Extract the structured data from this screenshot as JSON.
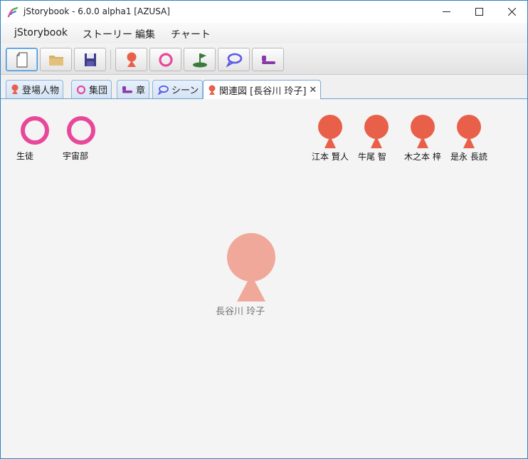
{
  "window": {
    "title": "jStorybook - 6.0.0 alpha1 [AZUSA]",
    "minimize_icon": "minimize-icon",
    "maximize_icon": "maximize-icon",
    "close_icon": "close-icon"
  },
  "menu": {
    "items": [
      "jStorybook",
      "ストーリー",
      "編集",
      "チャート"
    ]
  },
  "toolbar": {
    "buttons": [
      {
        "icon": "new-file-icon"
      },
      {
        "icon": "open-folder-icon"
      },
      {
        "icon": "save-icon"
      },
      {
        "icon": "person-icon"
      },
      {
        "icon": "group-ring-icon"
      },
      {
        "icon": "location-flag-icon"
      },
      {
        "icon": "scene-bubble-icon"
      },
      {
        "icon": "chapter-icon"
      }
    ]
  },
  "tabs": [
    {
      "label": "登場人物",
      "icon": "person-icon"
    },
    {
      "label": "集団",
      "icon": "group-ring-icon"
    },
    {
      "label": "章",
      "icon": "chapter-icon"
    },
    {
      "label": "シーン",
      "icon": "scene-bubble-icon"
    },
    {
      "label": "関連図 [長谷川 玲子]",
      "icon": "person-icon",
      "active": true,
      "close": "✕"
    }
  ],
  "diagram": {
    "groups": [
      {
        "label": "生徒"
      },
      {
        "label": "宇宙部"
      }
    ],
    "persons": [
      {
        "label": "江本 賢人"
      },
      {
        "label": "牛尾 智"
      },
      {
        "label": "木之本 梓"
      },
      {
        "label": "是永 長読"
      }
    ],
    "center": {
      "label": "長谷川 玲子"
    }
  },
  "colors": {
    "person": "#e8604a",
    "person_center": "#f0a89a",
    "group": "#e8489a",
    "tab_border": "#8db4dc",
    "accent": "#2a86c8"
  }
}
